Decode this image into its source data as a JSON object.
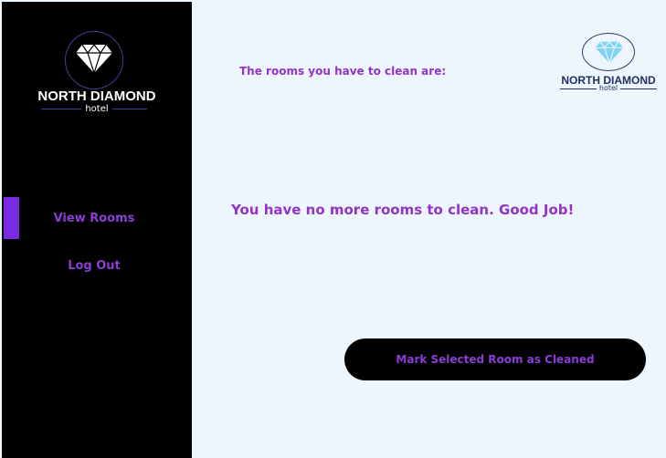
{
  "sidebar": {
    "logo": {
      "title": "NORTH DIAMOND",
      "subtitle": "hotel",
      "icon": "diamond-icon"
    },
    "nav": {
      "view_rooms": "View Rooms",
      "log_out": "Log Out"
    },
    "active_indicator_color": "#7a2ae0"
  },
  "main": {
    "header_text": "The rooms you have to clean are:",
    "brand_logo": {
      "title": "NORTH DIAMOND",
      "subtitle": "hotel",
      "icon": "diamond-icon"
    },
    "empty_message": "You have no more rooms to clean. Good Job!",
    "mark_button_label": "Mark Selected Room as Cleaned"
  },
  "colors": {
    "accent": "#9333c7",
    "sidebar_bg": "#000000",
    "page_bg": "#eef6fd",
    "brand_navy": "#1f2f5c",
    "diamond_light": "#7fd3f5"
  }
}
